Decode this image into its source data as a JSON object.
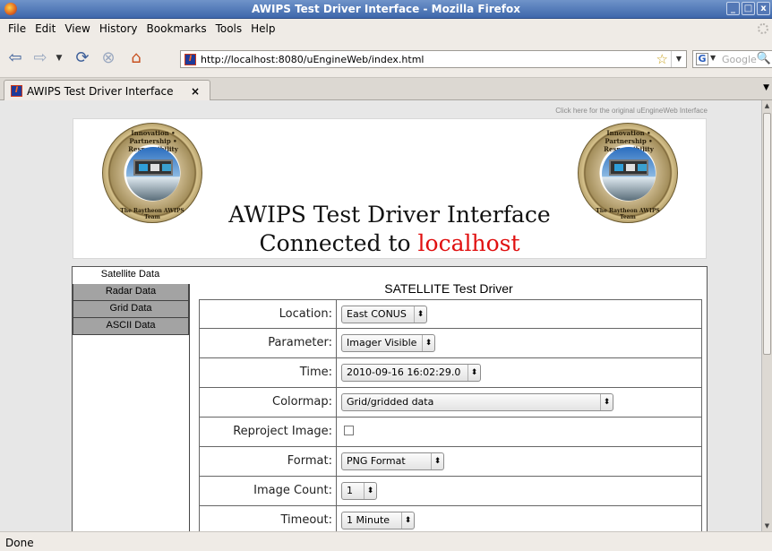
{
  "window": {
    "title": "AWIPS Test Driver Interface - Mozilla Firefox",
    "buttons": [
      "_",
      "□",
      "x"
    ]
  },
  "menu": [
    {
      "label": "File"
    },
    {
      "label": "Edit"
    },
    {
      "label": "View"
    },
    {
      "label": "History"
    },
    {
      "label": "Bookmarks"
    },
    {
      "label": "Tools"
    },
    {
      "label": "Help"
    }
  ],
  "nav": {
    "url": "http://localhost:8080/uEngineWeb/index.html",
    "search_placeholder": "Google",
    "icons": {
      "back": "arrow-left-icon",
      "forward": "arrow-right-icon",
      "reload": "reload-icon",
      "stop": "stop-icon",
      "home": "home-icon"
    }
  },
  "tab": {
    "label": "AWIPS Test Driver Interface",
    "close": "×"
  },
  "page": {
    "original_link": "Click here for the original uEngineWeb Interface",
    "headline1": "AWIPS Test Driver Interface",
    "headline2_prefix": "Connected to",
    "host": "localhost",
    "seal_top": "Innovation • Partnership • Responsibility",
    "seal_bottom": "The Raytheon AWIPS Team",
    "colors": {
      "host": "#e01010",
      "nav_inactive": "#a3a3a3"
    }
  },
  "sidenav": [
    {
      "label": "Satellite Data",
      "active": true
    },
    {
      "label": "Radar Data",
      "active": false
    },
    {
      "label": "Grid Data",
      "active": false
    },
    {
      "label": "ASCII Data",
      "active": false
    }
  ],
  "form": {
    "title": "SATELLITE Test Driver",
    "rows": [
      {
        "label": "Location:",
        "value": "East CONUS",
        "type": "select"
      },
      {
        "label": "Parameter:",
        "value": "Imager Visible",
        "type": "select"
      },
      {
        "label": "Time:",
        "value": "2010-09-16 16:02:29.0",
        "type": "select"
      },
      {
        "label": "Colormap:",
        "value": "Grid/gridded data",
        "type": "select"
      },
      {
        "label": "Reproject Image:",
        "value": "",
        "type": "checkbox"
      },
      {
        "label": "Format:",
        "value": "PNG Format",
        "type": "select"
      },
      {
        "label": "Image Count:",
        "value": "1",
        "type": "select"
      },
      {
        "label": "Timeout:",
        "value": "1 Minute",
        "type": "select"
      }
    ]
  },
  "status": "Done"
}
